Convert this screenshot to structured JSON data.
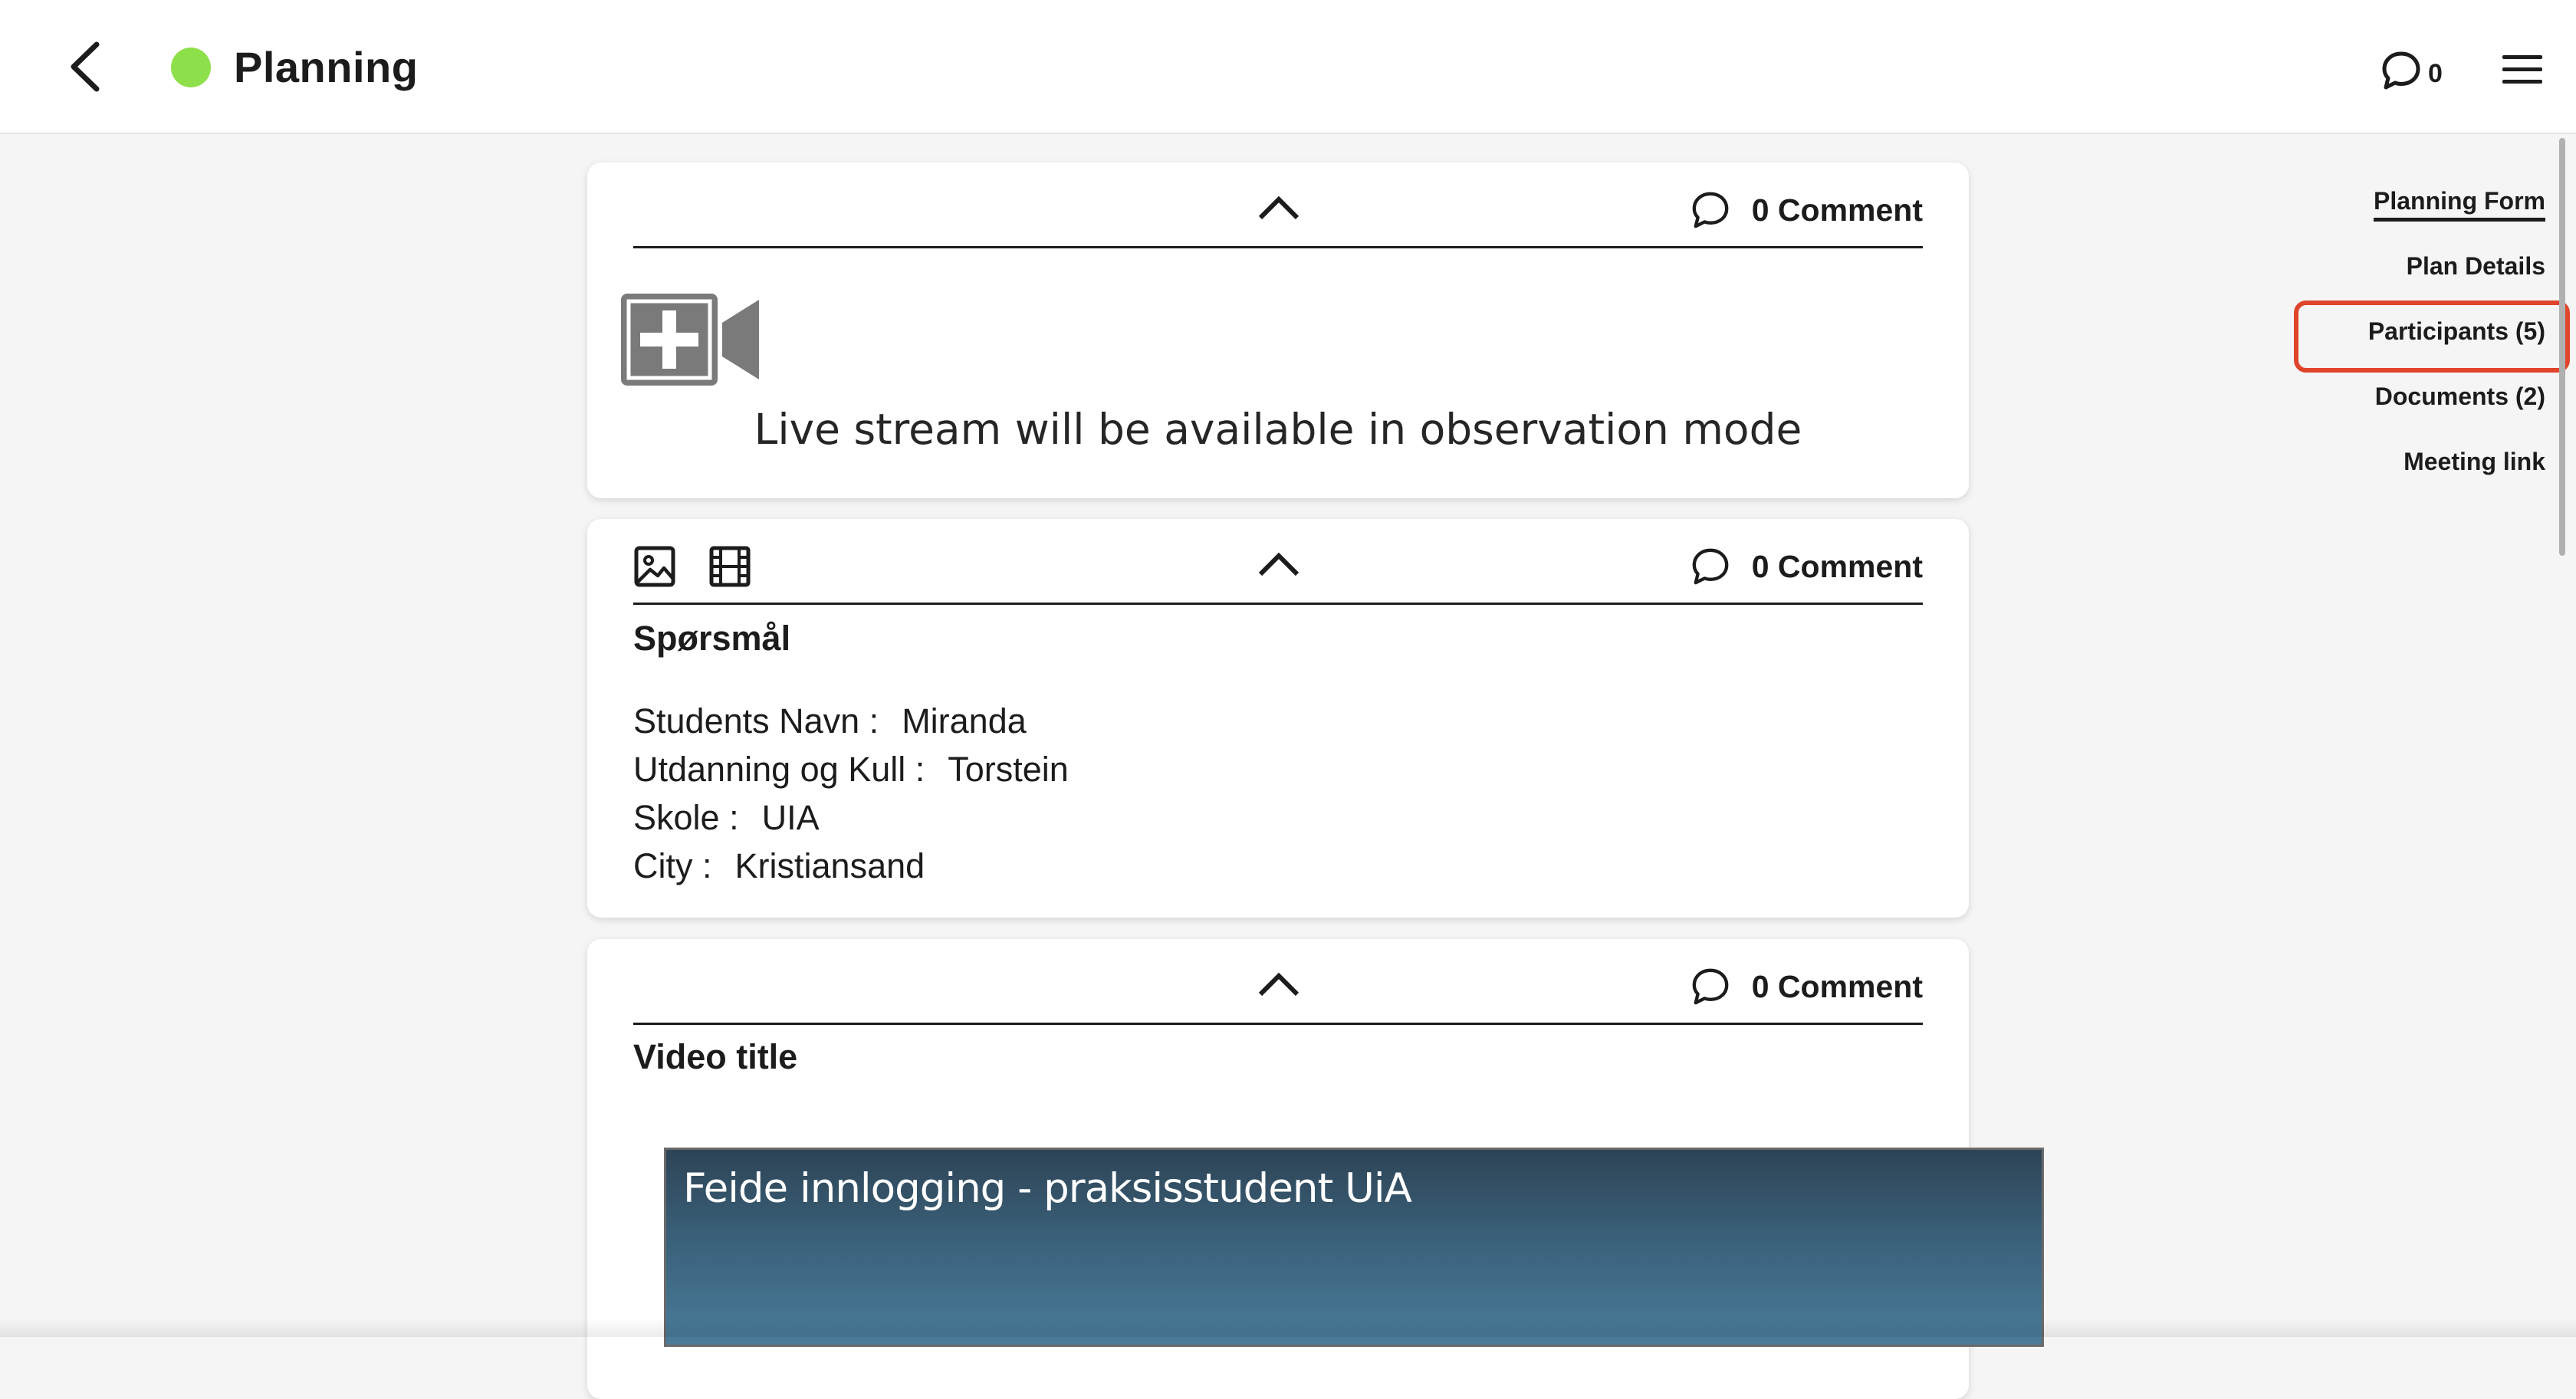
{
  "header": {
    "title": "Planning",
    "status_color": "#8ee04a",
    "comment_count": "0",
    "icons": {
      "back": "chevron-left-icon",
      "comments": "comment-bubble-icon",
      "menu": "hamburger-menu-icon"
    }
  },
  "cards": {
    "livestream": {
      "comment_label": "0 Comment",
      "message": "Live stream will be available in observation mode",
      "icon": "video-add-icon"
    },
    "questions": {
      "comment_label": "0 Comment",
      "heading": "Spørsmål",
      "fields": [
        {
          "label": "Students Navn :",
          "value": "Miranda"
        },
        {
          "label": "Utdanning og Kull :",
          "value": "Torstein"
        },
        {
          "label": "Skole :",
          "value": "UIA"
        },
        {
          "label": "City :",
          "value": "Kristiansand"
        }
      ],
      "media_icons": [
        "image-icon",
        "film-icon"
      ]
    },
    "video": {
      "comment_label": "0 Comment",
      "heading": "Video title",
      "embed_title": "Feide innlogging - praksisstudent UiA"
    }
  },
  "side_nav": {
    "items": [
      {
        "label": "Planning Form"
      },
      {
        "label": "Plan Details"
      },
      {
        "label": "Participants (5)"
      },
      {
        "label": "Documents (2)"
      },
      {
        "label": "Meeting link"
      }
    ],
    "active_index": 0,
    "highlight_index": 2,
    "highlight_color": "#e0452b"
  }
}
